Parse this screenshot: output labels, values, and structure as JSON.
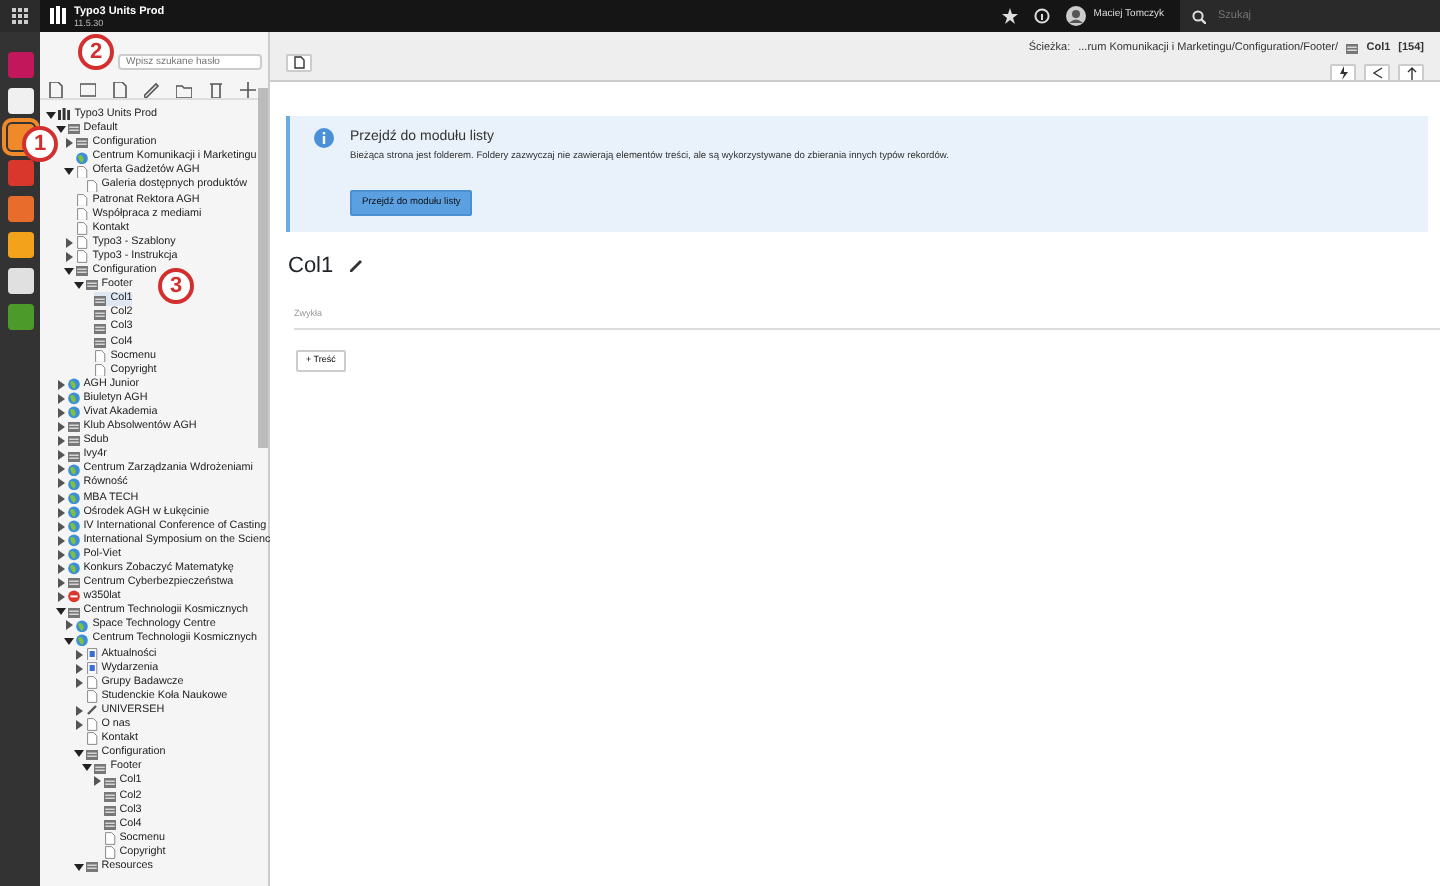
{
  "topbar": {
    "site_name": "Typo3 Units Prod",
    "version": "11.5.30",
    "user": "Maciej Tomczyk",
    "search": {
      "placeholder": "Szukaj"
    }
  },
  "modules": [
    {
      "color": "#c2185b",
      "selected": false
    },
    {
      "color": "#f0f0f0",
      "selected": false
    },
    {
      "color": "#ef8a2b",
      "selected": true
    },
    {
      "color": "#d9372b",
      "selected": false
    },
    {
      "color": "#e86c2c",
      "selected": false
    },
    {
      "color": "#f3a21c",
      "selected": false
    },
    {
      "color": "#e0e0e0",
      "selected": false
    },
    {
      "color": "#4c9a2a",
      "selected": false
    }
  ],
  "page_tree": {
    "filter": {
      "placeholder": "Wpisz szukane hasło"
    },
    "nodes": [
      {
        "title": "Typo3 Units Prod",
        "kind": "root",
        "expanded": true,
        "selected": false,
        "children": [
          {
            "title": "Default",
            "kind": "folder",
            "expanded": true,
            "selected": false,
            "children": [
              {
                "title": "Configuration",
                "kind": "folder",
                "expanded": false,
                "selected": false
              },
              {
                "title": "Centrum Komunikacji i Marketingu",
                "kind": "site",
                "selected": false
              },
              {
                "title": "Oferta Gadżetów AGH",
                "kind": "page",
                "expanded": true,
                "selected": false,
                "children": [
                  {
                    "title": "Galeria dostępnych produktów",
                    "kind": "page",
                    "selected": false
                  }
                ]
              },
              {
                "title": "Patronat Rektora AGH",
                "kind": "page",
                "selected": false
              },
              {
                "title": "Współpraca z mediami",
                "kind": "page",
                "selected": false
              },
              {
                "title": "Kontakt",
                "kind": "page",
                "selected": false
              },
              {
                "title": "Typo3 - Szablony",
                "kind": "page",
                "expanded": false,
                "selected": false
              },
              {
                "title": "Typo3 - Instrukcja",
                "kind": "page",
                "expanded": false,
                "selected": false
              },
              {
                "title": "Configuration",
                "kind": "folder",
                "expanded": true,
                "selected": false,
                "children": [
                  {
                    "title": "Footer",
                    "kind": "folder",
                    "expanded": true,
                    "selected": false,
                    "children": [
                      {
                        "title": "Col1",
                        "kind": "folder",
                        "selected": true
                      },
                      {
                        "title": "Col2",
                        "kind": "folder",
                        "selected": false
                      },
                      {
                        "title": "Col3",
                        "kind": "folder",
                        "selected": false
                      },
                      {
                        "title": "Col4",
                        "kind": "folder",
                        "selected": false
                      },
                      {
                        "title": "Socmenu",
                        "kind": "page",
                        "selected": false
                      },
                      {
                        "title": "Copyright",
                        "kind": "page",
                        "selected": false
                      }
                    ]
                  }
                ]
              }
            ]
          },
          {
            "title": "AGH Junior",
            "kind": "site",
            "expanded": false,
            "selected": false
          },
          {
            "title": "Biuletyn AGH",
            "kind": "site",
            "expanded": false,
            "selected": false
          },
          {
            "title": "Vivat Akademia",
            "kind": "site",
            "expanded": false,
            "selected": false
          },
          {
            "title": "Klub Absolwentów AGH",
            "kind": "folder",
            "expanded": false,
            "selected": false
          },
          {
            "title": "Sdub",
            "kind": "folder",
            "expanded": false,
            "selected": false
          },
          {
            "title": "Ivy4r",
            "kind": "folder",
            "expanded": false,
            "selected": false
          },
          {
            "title": "Centrum Zarządzania Wdrożeniami",
            "kind": "site",
            "expanded": false,
            "selected": false
          },
          {
            "title": "Równość",
            "kind": "site",
            "expanded": false,
            "selected": false
          },
          {
            "title": "MBA TECH",
            "kind": "site",
            "expanded": false,
            "selected": false
          },
          {
            "title": "Ośrodek AGH w Łukęcinie",
            "kind": "site",
            "expanded": false,
            "selected": false
          },
          {
            "title": "IV International Conference of Casting",
            "kind": "site",
            "expanded": false,
            "selected": false
          },
          {
            "title": "International Symposium on the Scienc",
            "kind": "site",
            "expanded": false,
            "selected": false
          },
          {
            "title": "Pol-Viet",
            "kind": "site",
            "expanded": false,
            "selected": false
          },
          {
            "title": "Konkurs Zobaczyć Matematykę",
            "kind": "site",
            "expanded": false,
            "selected": false
          },
          {
            "title": "Centrum Cyberbezpieczeństwa",
            "kind": "folder",
            "expanded": false,
            "selected": false
          },
          {
            "title": "w350lat",
            "kind": "restricted",
            "expanded": false,
            "selected": false
          },
          {
            "title": "Centrum Technologii Kosmicznych",
            "kind": "folder",
            "expanded": true,
            "selected": false,
            "children": [
              {
                "title": "Space Technology Centre",
                "kind": "site",
                "expanded": false,
                "selected": false
              },
              {
                "title": "Centrum Technologii Kosmicznych",
                "kind": "site",
                "expanded": true,
                "selected": false,
                "children": [
                  {
                    "title": "Aktualności",
                    "kind": "list",
                    "expanded": false,
                    "selected": false
                  },
                  {
                    "title": "Wydarzenia",
                    "kind": "list",
                    "expanded": false,
                    "selected": false
                  },
                  {
                    "title": "Grupy Badawcze",
                    "kind": "page",
                    "expanded": false,
                    "selected": false
                  },
                  {
                    "title": "Studenckie Koła Naukowe",
                    "kind": "page",
                    "selected": false
                  },
                  {
                    "title": "UNIVERSEH",
                    "kind": "link",
                    "expanded": false,
                    "selected": false
                  },
                  {
                    "title": "O nas",
                    "kind": "page",
                    "expanded": false,
                    "selected": false
                  },
                  {
                    "title": "Kontakt",
                    "kind": "page",
                    "selected": false
                  },
                  {
                    "title": "Configuration",
                    "kind": "folder",
                    "expanded": true,
                    "selected": false,
                    "children": [
                      {
                        "title": "Footer",
                        "kind": "folder",
                        "expanded": true,
                        "selected": false,
                        "children": [
                          {
                            "title": "Col1",
                            "kind": "folder",
                            "expanded": false,
                            "selected": false
                          },
                          {
                            "title": "Col2",
                            "kind": "folder",
                            "selected": false
                          },
                          {
                            "title": "Col3",
                            "kind": "folder",
                            "selected": false
                          },
                          {
                            "title": "Col4",
                            "kind": "folder",
                            "selected": false
                          },
                          {
                            "title": "Socmenu",
                            "kind": "page",
                            "selected": false
                          },
                          {
                            "title": "Copyright",
                            "kind": "page",
                            "selected": false
                          }
                        ]
                      }
                    ]
                  },
                  {
                    "title": "Resources",
                    "kind": "folder",
                    "expanded": true,
                    "selected": false
                  }
                ]
              }
            ]
          }
        ]
      }
    ]
  },
  "docheader": {
    "path_label": "Ścieżka:",
    "path": "...rum Komunikacji i Marketingu/Configuration/Footer/",
    "page_title": "Col1",
    "page_id": "[154]"
  },
  "infobox": {
    "title": "Przejdź do modułu listy",
    "text": "Bieżąca strona jest folderem. Foldery zazwyczaj nie zawierają elementów treści, ale są wykorzystywane do zbierania innych typów rekordów.",
    "button": "Przejdź do modułu listy"
  },
  "page_heading": "Col1",
  "column": {
    "title": "Zwykła",
    "button": "+ Treść"
  },
  "callouts": [
    {
      "label": "1"
    },
    {
      "label": "2"
    },
    {
      "label": "3"
    }
  ]
}
